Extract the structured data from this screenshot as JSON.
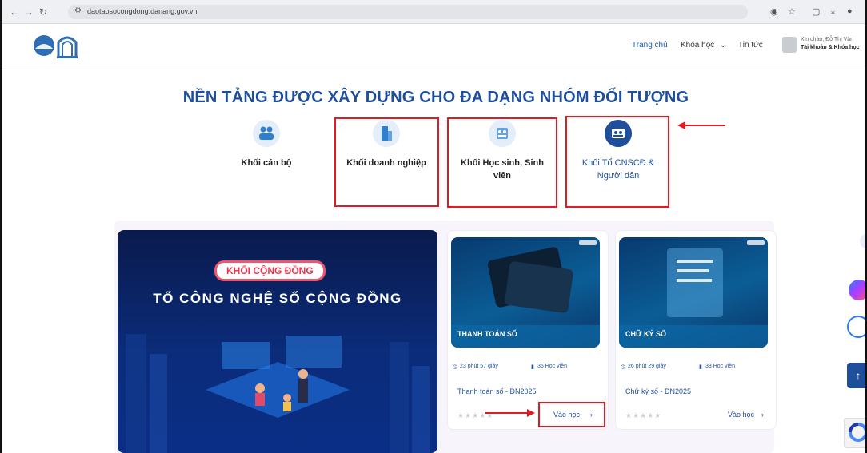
{
  "browser": {
    "url": "daotaosocongdong.danang.gov.vn"
  },
  "header": {
    "nav": [
      {
        "label": "Trang chủ"
      },
      {
        "label": "Khóa học"
      },
      {
        "label": "Tin tức"
      }
    ],
    "account_line1": "Xin chào, Đỗ Thị Vân",
    "account_line2": "Tài khoản & Khóa học"
  },
  "section": {
    "title": "NỀN TẢNG ĐƯỢC XÂY DỰNG CHO ĐA DẠNG NHÓM ĐỐI TƯỢNG"
  },
  "categories": [
    {
      "label": "Khối cán bộ"
    },
    {
      "label": "Khối doanh nghiệp"
    },
    {
      "label": "Khối Học sinh, Sinh viên"
    },
    {
      "label": "Khối Tổ CNSCĐ & Người dân",
      "selected": true
    }
  ],
  "banner": {
    "badge": "KHỐI CỘNG ĐỒNG",
    "title": "TỔ CÔNG NGHỆ SỐ CỘNG ĐỒNG"
  },
  "courses": [
    {
      "thumb_title": "THANH TOÁN SỐ",
      "duration": "23 phút 57 giây",
      "students": "36 Học viên",
      "name": "Thanh toán số - ĐN2025",
      "action": "Vào học"
    },
    {
      "thumb_title": "CHỮ KÝ SỐ",
      "duration": "26 phút 29 giây",
      "students": "33 Học viên",
      "name": "Chữ ký số - ĐN2025",
      "action": "Vào học"
    }
  ],
  "colors": {
    "brand_blue": "#1f4f9b",
    "highlight_red": "#e01b24"
  }
}
